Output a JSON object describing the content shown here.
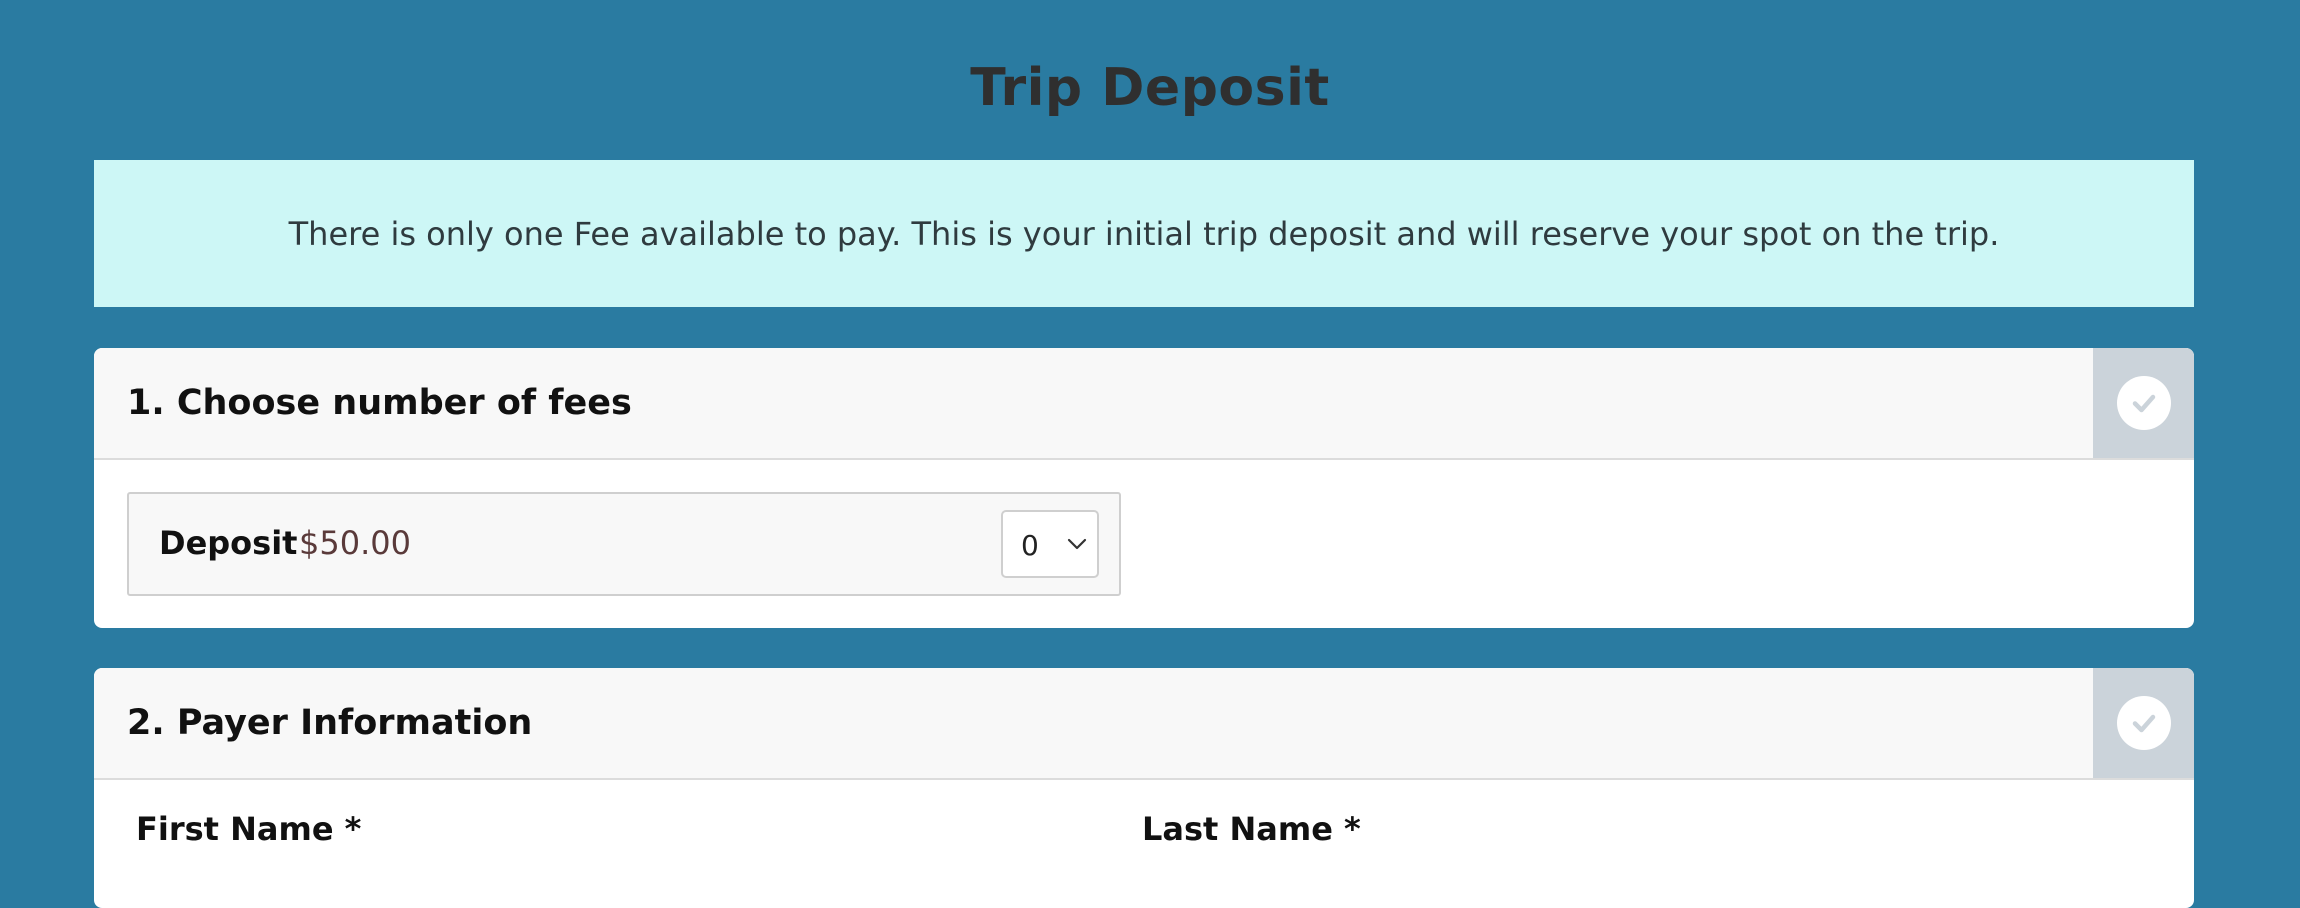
{
  "page": {
    "title": "Trip Deposit",
    "notice": "There is only one Fee available to pay. This is your initial trip deposit and will reserve your spot on the trip."
  },
  "section_fees": {
    "title": "1. Choose number of fees",
    "status_icon": "check-circle-icon",
    "fee": {
      "name": "Deposit",
      "price": "$50.00",
      "quantity": "0"
    }
  },
  "section_payer": {
    "title": "2. Payer Information",
    "status_icon": "check-circle-icon",
    "first_name_label": "First Name *",
    "last_name_label": "Last Name *"
  },
  "colors": {
    "background": "#2a7ba1",
    "notice_bg": "#cdf7f6",
    "check_tab_bg": "#cbd3da",
    "price_text": "#5a3a3a"
  }
}
